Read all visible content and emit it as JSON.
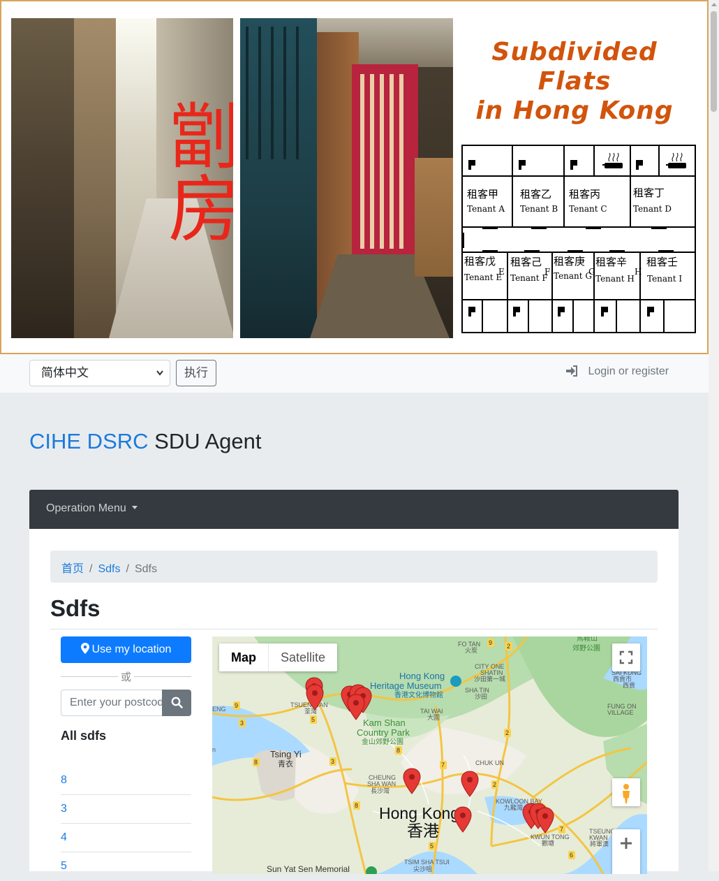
{
  "banner": {
    "glyph_top": "劏",
    "glyph_bottom": "房",
    "title_line1": "Subdivided Flats",
    "title_line2": "in Hong Kong",
    "tenants_top": [
      {
        "zh": "租客甲",
        "en": "Tenant A"
      },
      {
        "zh": "租客乙",
        "en": "Tenant B"
      },
      {
        "zh": "租客丙",
        "en": "Tenant C"
      },
      {
        "zh": "租客丁",
        "en": "Tenant D"
      }
    ],
    "tenants_bottom": [
      {
        "zh": "租客戊",
        "en": "Tenant E"
      },
      {
        "zh": "租客己",
        "en": "Tenant F"
      },
      {
        "zh": "租客庚",
        "en": "Tenant G"
      },
      {
        "zh": "租客辛",
        "en": "Tenant H"
      },
      {
        "zh": "租客壬",
        "en": "Tenant I"
      }
    ],
    "door_letters": [
      "E",
      "F",
      "G",
      "H"
    ]
  },
  "topbar": {
    "language_selected": "简体中文",
    "go_label": "执行",
    "login_label": "Login or register"
  },
  "site": {
    "title_accent": "CIHE DSRC",
    "title_rest": "SDU Agent"
  },
  "nav": {
    "menu_label": "Operation Menu"
  },
  "breadcrumb": {
    "home": "首页",
    "section": "Sdfs",
    "current": "Sdfs"
  },
  "page": {
    "heading": "Sdfs"
  },
  "sidebar": {
    "use_location_label": "Use my location",
    "or_label": "或",
    "postcode_placeholder": "Enter your postcode",
    "all_title": "All sdfs",
    "items": [
      "8",
      "3",
      "4",
      "5"
    ]
  },
  "map": {
    "type_map": "Map",
    "type_satellite": "Satellite",
    "labels": {
      "fo_tan": "FO TAN",
      "fo_tan_zh": "火炭",
      "ma_on_shan": "馬鞍山",
      "ma_on_shan2": "郊野公園",
      "city_one": "CITY ONE",
      "shatin": "SHATIN",
      "shatin_zh": "沙田第一城",
      "hk_heritage": "Hong Kong",
      "hk_heritage2": "Heritage Museum",
      "hk_heritage_zh": "香港文化博物館",
      "sha_tin": "SHA TIN",
      "sha_tin_zh": "沙田",
      "sai_kung": "SAI KUNG",
      "sai_kung_zh": "西貢市",
      "sai_kung_zh2": "西貢",
      "tai_wai": "TAI WAI",
      "tai_wai_zh": "大圍",
      "tsuen_wan": "TSUEN WAN",
      "tsuen_wan_zh": "荃灣",
      "kam_shan": "Kam Shan",
      "kam_shan2": "Country Park",
      "kam_shan_zh": "金山郊野公園",
      "fung_on": "FUNG ON",
      "village": "VILLAGE",
      "tsing_yi": "Tsing Yi",
      "tsing_yi_zh": "青衣",
      "chuk_un": "CHUK UN",
      "cheung_sha_wan": "CHEUNG",
      "cheung_sha_wan2": "SHA WAN",
      "cheung_sha_wan_zh": "長沙灣",
      "kowloon_bay": "KOWLOON BAY",
      "kowloon_bay_zh": "九龍灣",
      "hong_kong": "Hong Kong",
      "hong_kong_zh": "香港",
      "kwun_tong": "KWUN TONG",
      "kwun_tong_zh": "觀塘",
      "tseung_kwan": "TSEUNG",
      "tseung_kwan2": "KWAN",
      "tseung_kwan_zh": "將軍澳",
      "sun_yat_sen": "Sun Yat Sen Memorial",
      "tsim_sha_tsui": "TSIM SHA TSUI",
      "tsim_sha_tsui_zh": "尖沙咀",
      "eng": "ENG",
      "n": "n"
    }
  },
  "colors": {
    "accent_blue": "#1b7bdc",
    "button_blue": "#0d7bff",
    "navbar": "#343a40",
    "banner_title": "#d2540c",
    "banner_glyph": "#e8271a",
    "banner_border": "#d9a45b",
    "marker_red": "#e53935"
  },
  "icons": {
    "login": "sign-in-icon",
    "location": "map-marker-icon",
    "search": "search-icon",
    "fullscreen": "fullscreen-icon",
    "pegman": "pegman-icon",
    "zoom_in": "plus-icon"
  }
}
